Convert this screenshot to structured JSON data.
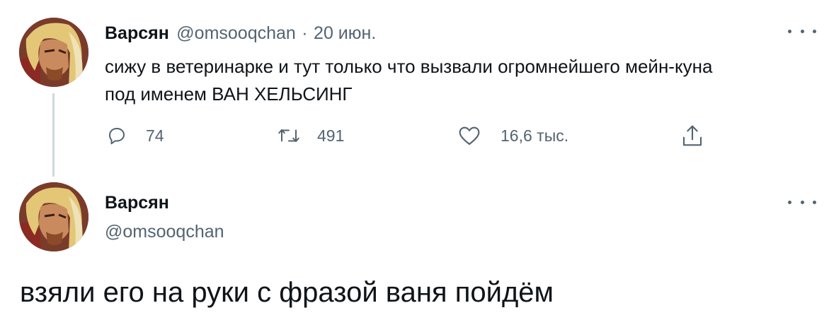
{
  "tweet": {
    "name": "Варсян",
    "handle": "@omsooqchan",
    "separator": "·",
    "date": "20 июн.",
    "text_line1": "сижу в ветеринарке и тут только что вызвали огромнейшего мейн-куна",
    "text_line2": "под именем ВАН ХЕЛЬСИНГ",
    "actions": {
      "replies": "74",
      "retweets": "491",
      "likes": "16,6 тыс."
    },
    "icons": [
      "avatar",
      "more-icon",
      "reply-icon",
      "retweet-icon",
      "like-icon",
      "share-icon"
    ]
  },
  "reply": {
    "name": "Варсян",
    "handle": "@omsooqchan",
    "text": "взяли его на руки с фразой ваня пойдём"
  },
  "colors": {
    "text": "#0f1419",
    "secondary": "#536471",
    "thread_line": "#cfd9de",
    "background": "#ffffff"
  }
}
